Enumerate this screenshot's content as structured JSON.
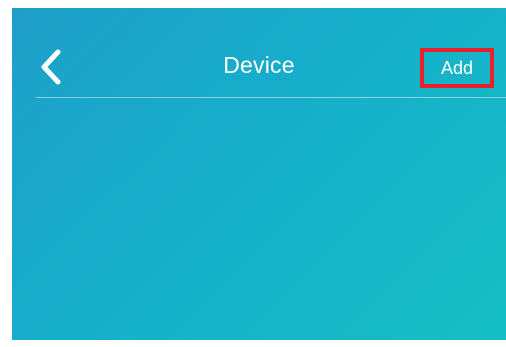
{
  "header": {
    "title": "Device",
    "add_label": "Add",
    "back_icon": "chevron-left-icon"
  },
  "colors": {
    "gradient_start": "#1e9fc9",
    "gradient_end": "#14c0c3",
    "highlight_border": "#e8212b",
    "text": "#ffffff"
  },
  "device_list": {
    "items": []
  }
}
